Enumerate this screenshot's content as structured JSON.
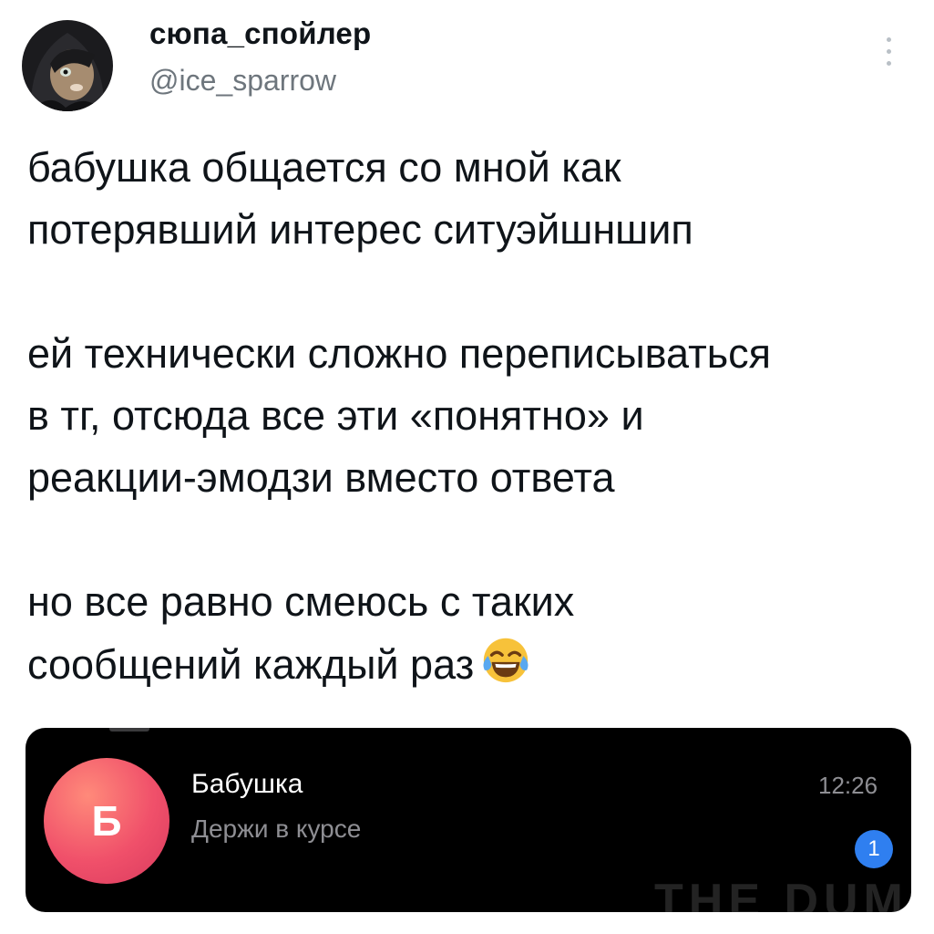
{
  "tweet": {
    "author": {
      "display_name": "сюпа_спойлер",
      "handle": "@ice_sparrow",
      "avatar_icon": "hooded-cat-avatar"
    },
    "more_icon": "vertical-ellipsis-icon",
    "paragraphs": [
      "бабушка общается со мной как\nпотерявший интерес ситуэйшншип",
      "ей технически сложно переписываться\nв тг, отсюда все эти «понятно» и\nреакции-эмодзи вместо ответа",
      "но все равно смеюсь с таких\nсообщений каждый раз"
    ],
    "emoji": "tears-of-joy-emoji"
  },
  "telegram_chat": {
    "avatar_letter": "Б",
    "avatar_colors": [
      "#ff8a7a",
      "#f0506a"
    ],
    "name": "Бабушка",
    "preview": "Держи в курсе",
    "time": "12:26",
    "unread_count": "1",
    "badge_color": "#2f7ff0"
  },
  "watermark": "THE DUMP"
}
